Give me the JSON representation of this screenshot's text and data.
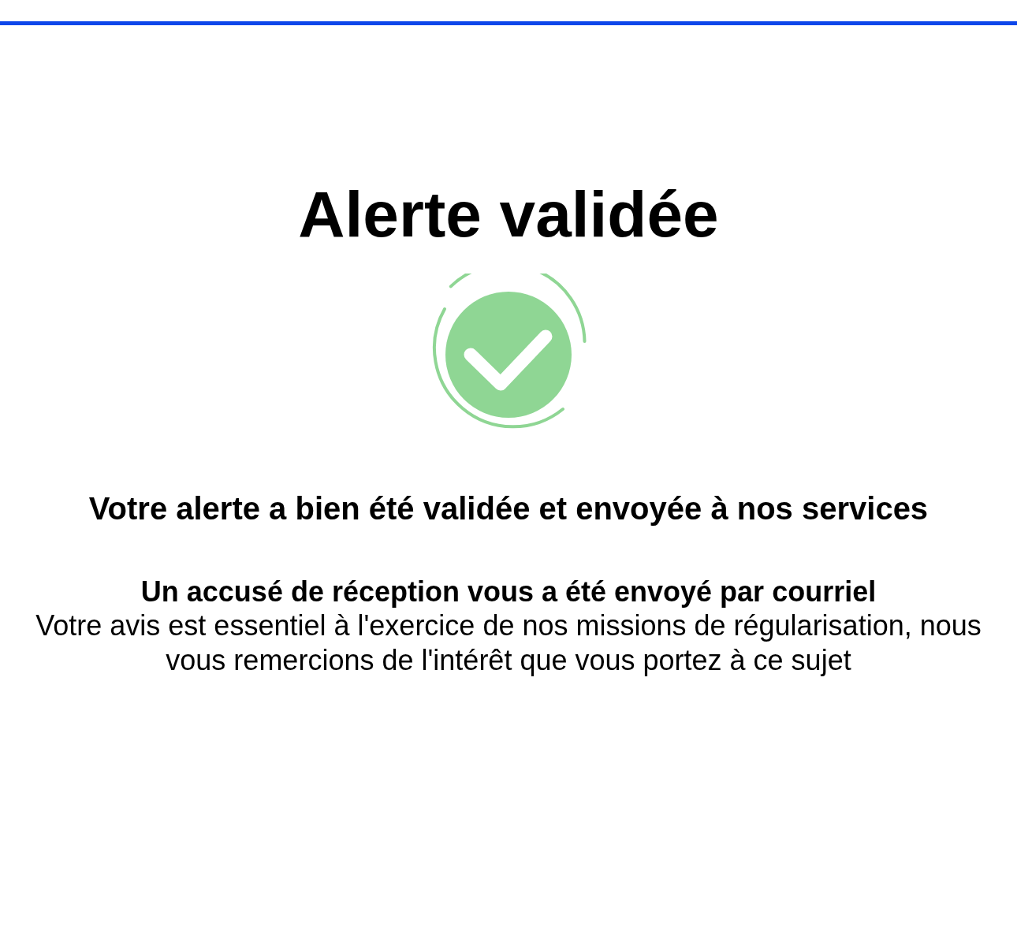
{
  "title": "Alerte validée",
  "subtitle": "Votre alerte a bien été validée et envoyée à nos services",
  "acknowledgement": "Un accusé de réception vous a été envoyé par courriel",
  "message": "Votre avis est essentiel à l'exercice de nos missions de régularisation, nous vous remercions de l'intérêt que vous portez à ce sujet"
}
